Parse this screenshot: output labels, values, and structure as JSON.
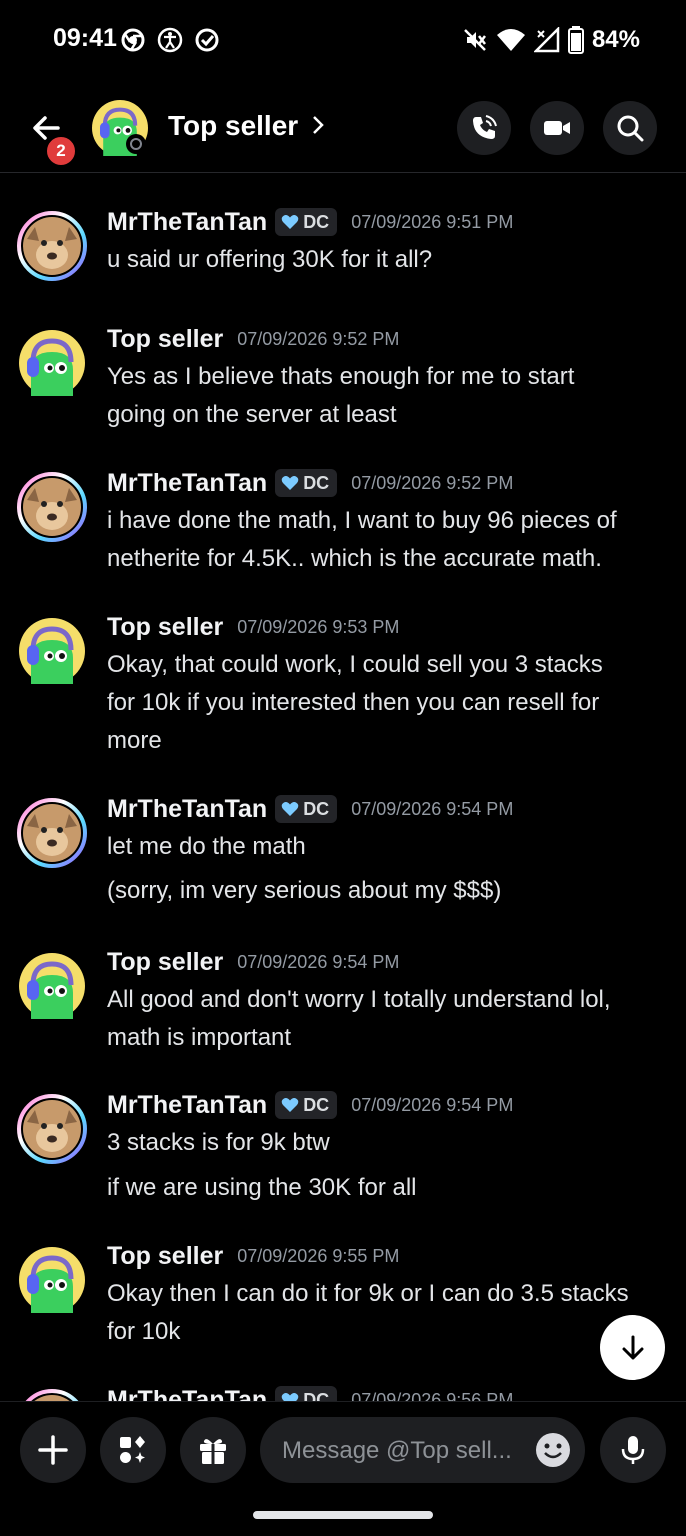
{
  "status_bar": {
    "time": "09:41",
    "battery": "84%",
    "left_icons": [
      "chrome-icon",
      "accessibility-icon",
      "check-circle-icon"
    ],
    "right_icons": [
      "mute-icon",
      "wifi-icon",
      "signal-icon",
      "battery-icon"
    ]
  },
  "header": {
    "title": "Top seller",
    "unread_badge": "2",
    "buttons": [
      "call-button",
      "video-button",
      "search-button"
    ]
  },
  "messages": [
    {
      "author": "MrTheTanTan",
      "tag": "DC",
      "time": "07/09/2026 9:51 PM",
      "lines": [
        "u said ur offering 30K for it all?"
      ]
    },
    {
      "author": "Top seller",
      "tag": "",
      "time": "07/09/2026 9:52 PM",
      "lines": [
        "Yes as I believe thats enough for me to start",
        "going on the server at least"
      ]
    },
    {
      "author": "MrTheTanTan",
      "tag": "DC",
      "time": "07/09/2026 9:52 PM",
      "lines": [
        "i have done the math, I want to buy 96 pieces of",
        "netherite for 4.5K.. which is the accurate math."
      ]
    },
    {
      "author": "Top seller",
      "tag": "",
      "time": "07/09/2026 9:53 PM",
      "lines": [
        "Okay, that could work, I could sell you 3 stacks",
        "for 10k if you interested then you can resell for",
        "more"
      ]
    },
    {
      "author": "MrTheTanTan",
      "tag": "DC",
      "time": "07/09/2026 9:54 PM",
      "lines": [
        "let me do the math",
        "(sorry, im very serious about my $$$)"
      ]
    },
    {
      "author": "Top seller",
      "tag": "",
      "time": "07/09/2026 9:54 PM",
      "lines": [
        "All good and don't worry I totally understand lol,",
        "math is important"
      ]
    },
    {
      "author": "MrTheTanTan",
      "tag": "DC",
      "time": "07/09/2026 9:54 PM",
      "lines": [
        "3 stacks is for 9k btw",
        "if we are using the 30K for all"
      ]
    },
    {
      "author": "Top seller",
      "tag": "",
      "time": "07/09/2026 9:55 PM",
      "lines": [
        "Okay then I can do it for 9k or I can do 3.5 stacks",
        "for 10k"
      ]
    },
    {
      "author": "MrTheTanTan",
      "tag": "DC",
      "time": "07/09/2026 9:56 PM",
      "lines": []
    }
  ],
  "composer": {
    "placeholder": "Message @Top sell...",
    "buttons": [
      "add-button",
      "apps-button",
      "gift-button",
      "emoji-button",
      "voice-message-button"
    ]
  },
  "colors": {
    "background": "#000000",
    "surface": "#1e1f22",
    "text": "#e3e5e8",
    "timestamp": "#949ba4",
    "badge": "#e03b3b",
    "tag_heart": "#7ccbff",
    "seller_avatar_bg": "#f5de6a",
    "seller_avatar_body": "#3bcf5e"
  }
}
